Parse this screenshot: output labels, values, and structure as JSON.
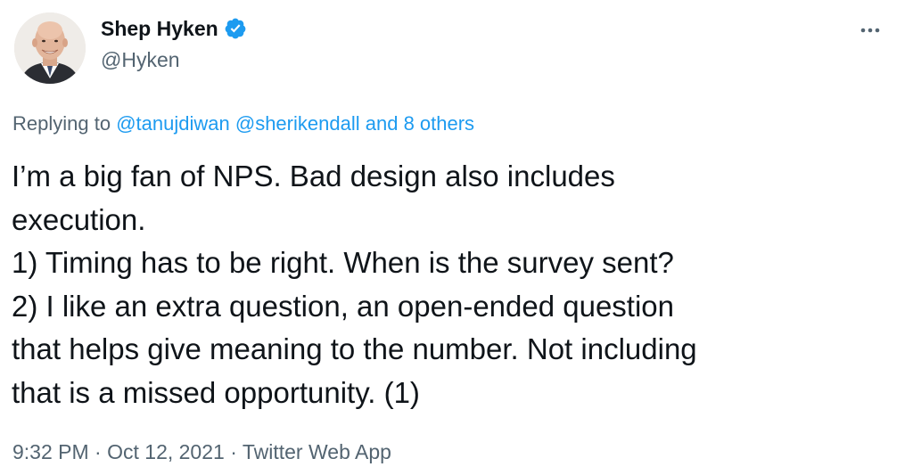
{
  "author": {
    "name": "Shep Hyken",
    "handle": "@Hyken",
    "verified": true
  },
  "more_icon": "more-horizontal-icon",
  "reply": {
    "prefix": "Replying to",
    "mention_1": "@tanujdiwan",
    "mention_2": "@sherikendall",
    "and": "and",
    "others": "8 others"
  },
  "tweet": {
    "lines": [
      "I’m a big fan of NPS. Bad design also includes",
      "execution.",
      "1) Timing has to be right. When is the survey sent?",
      "2) I like an extra question, an open-ended question",
      "that helps give meaning to the number. Not including",
      "that is a missed opportunity. (1)"
    ]
  },
  "meta": {
    "time": "9:32 PM",
    "sep1": "·",
    "date": "Oct 12, 2021",
    "sep2": "·",
    "source": "Twitter Web App"
  },
  "colors": {
    "text": "#0f1419",
    "secondary": "#536471",
    "link": "#1d9bf0",
    "verified": "#1d9bf0"
  }
}
